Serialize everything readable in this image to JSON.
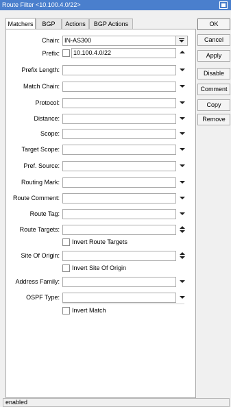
{
  "window": {
    "title": "Route Filter <10.100.4.0/22>"
  },
  "tabs": [
    {
      "label": "Matchers"
    },
    {
      "label": "BGP"
    },
    {
      "label": "Actions"
    },
    {
      "label": "BGP Actions"
    }
  ],
  "form": {
    "chain": {
      "label": "Chain:",
      "value": "IN-AS300"
    },
    "prefix": {
      "label": "Prefix:",
      "value": "10.100.4.0/22"
    },
    "prefix_length": {
      "label": "Prefix Length:",
      "value": ""
    },
    "match_chain": {
      "label": "Match Chain:",
      "value": ""
    },
    "protocol": {
      "label": "Protocol:",
      "value": ""
    },
    "distance": {
      "label": "Distance:",
      "value": ""
    },
    "scope": {
      "label": "Scope:",
      "value": ""
    },
    "target_scope": {
      "label": "Target Scope:",
      "value": ""
    },
    "pref_source": {
      "label": "Pref. Source:",
      "value": ""
    },
    "routing_mark": {
      "label": "Routing Mark:",
      "value": ""
    },
    "route_comment": {
      "label": "Route Comment:",
      "value": ""
    },
    "route_tag": {
      "label": "Route Tag:",
      "value": ""
    },
    "route_targets": {
      "label": "Route Targets:",
      "value": ""
    },
    "invert_route_targets": {
      "label": "Invert Route Targets"
    },
    "site_of_origin": {
      "label": "Site Of Origin:",
      "value": ""
    },
    "invert_site_of_origin": {
      "label": "Invert Site Of Origin"
    },
    "address_family": {
      "label": "Address Family:",
      "value": ""
    },
    "ospf_type": {
      "label": "OSPF Type:",
      "value": ""
    },
    "invert_match": {
      "label": "Invert Match"
    }
  },
  "buttons": {
    "ok": "OK",
    "cancel": "Cancel",
    "apply": "Apply",
    "disable": "Disable",
    "comment": "Comment",
    "copy": "Copy",
    "remove": "Remove"
  },
  "status": {
    "text": "enabled"
  },
  "colors": {
    "titlebar": "#4a7fcd",
    "background": "#f0f0f0"
  }
}
